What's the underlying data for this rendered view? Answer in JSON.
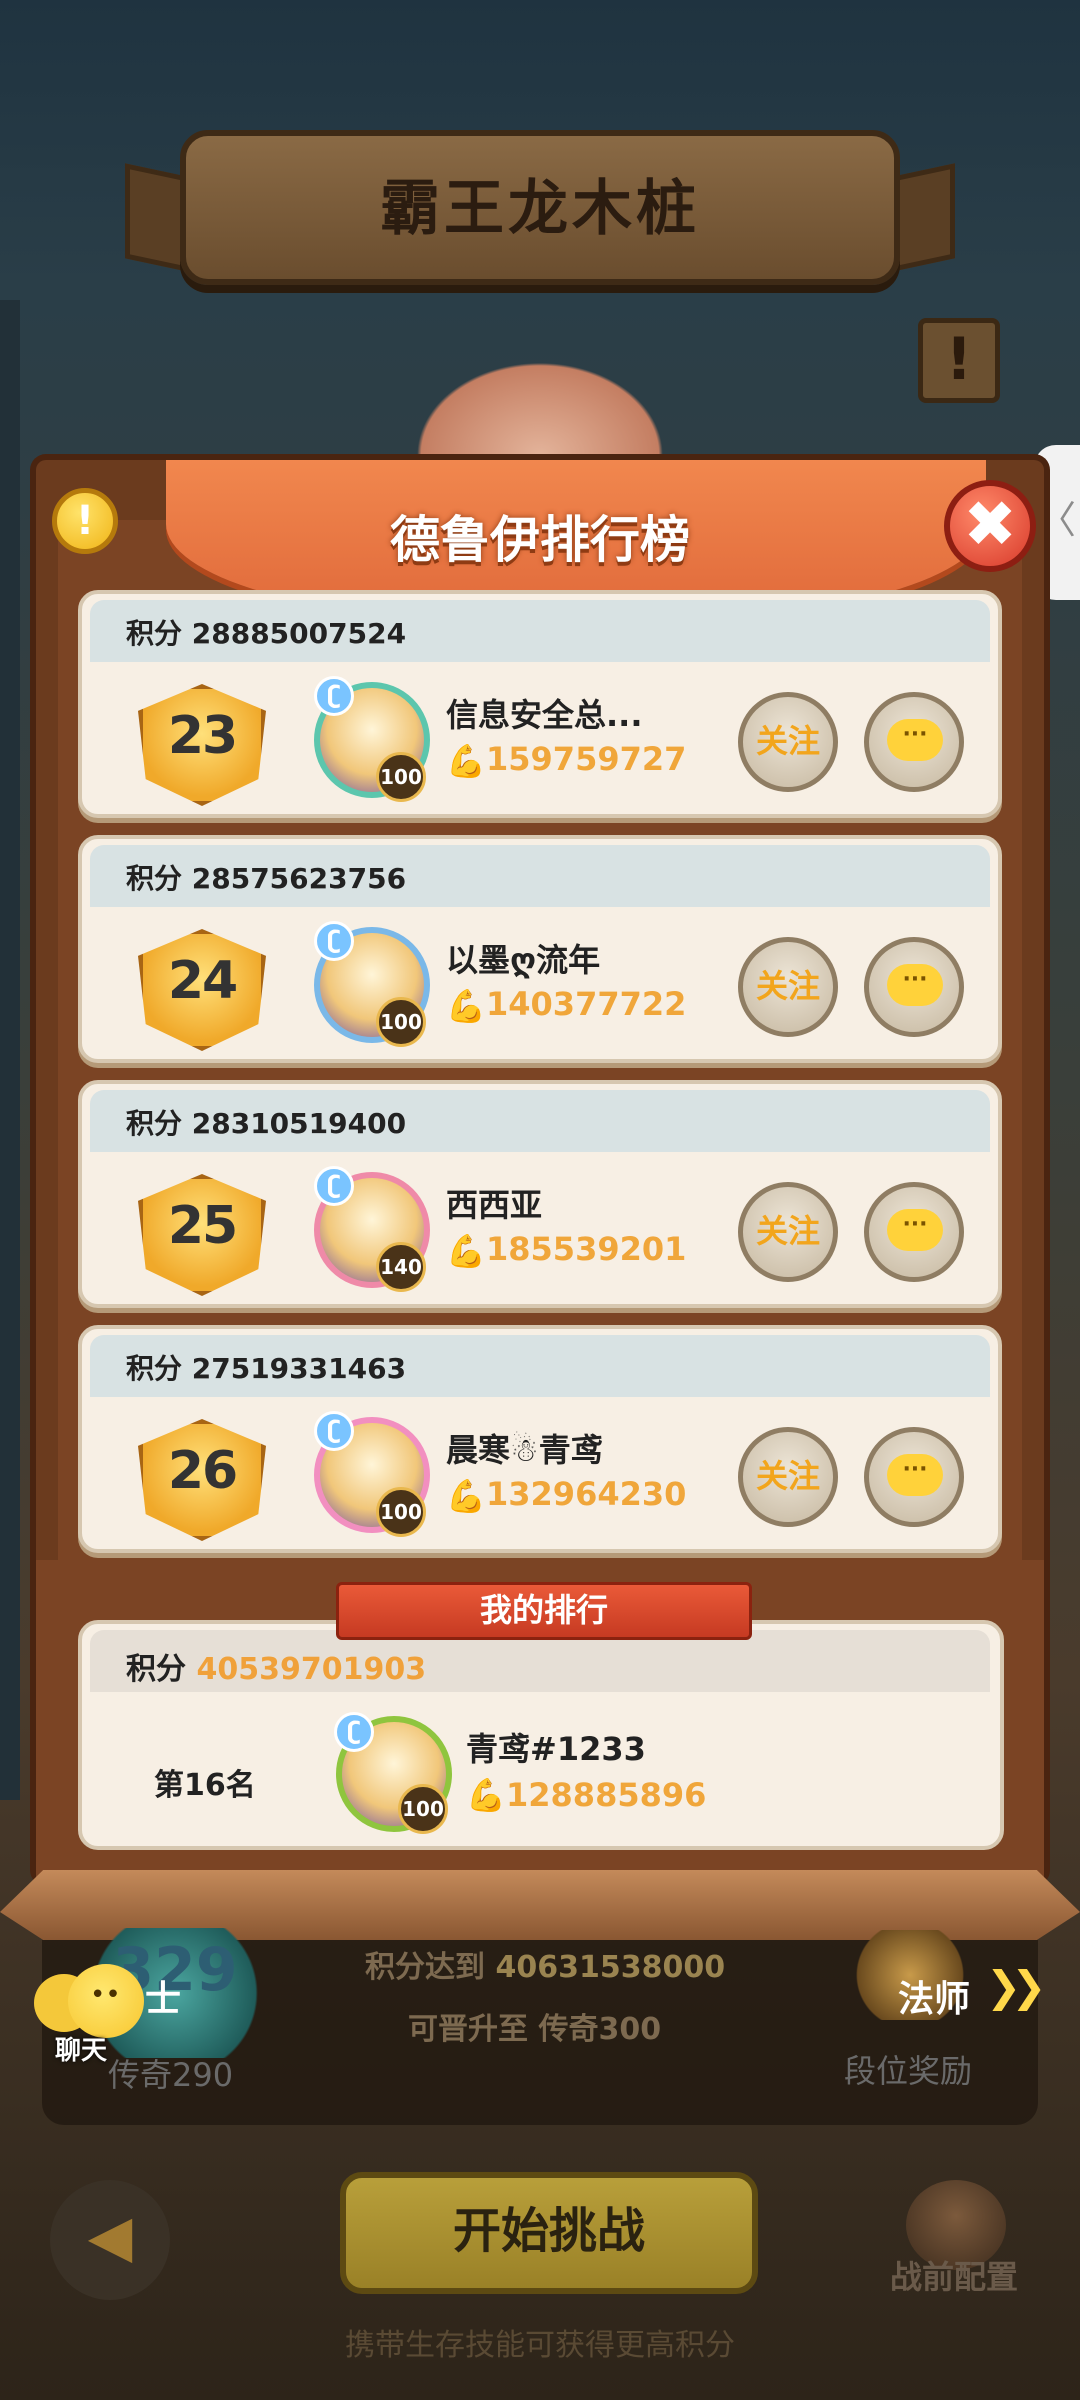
{
  "page": {
    "title": "霸王龙木桩",
    "side_handle_glyph": "〈",
    "sign_glyph": "!"
  },
  "panel": {
    "title": "德鲁伊排行榜",
    "info_glyph": "!",
    "close_glyph": "✖"
  },
  "rank_list": [
    {
      "score_label": "积分 28885007524",
      "rank": "23",
      "level": "100",
      "name": "信息安全总...",
      "power": "159759727",
      "follow": "关注",
      "chat": "···"
    },
    {
      "score_label": "积分 28575623756",
      "rank": "24",
      "level": "100",
      "name": "以墨ღ流年",
      "power": "140377722",
      "follow": "关注",
      "chat": "···"
    },
    {
      "score_label": "积分 28310519400",
      "rank": "25",
      "level": "140",
      "name": "西西亚",
      "power": "185539201",
      "follow": "关注",
      "chat": "···"
    },
    {
      "score_label": "积分 27519331463",
      "rank": "26",
      "level": "100",
      "name": "晨寒☃青鸢",
      "power": "132964230",
      "follow": "关注",
      "chat": "···"
    }
  ],
  "my_rank": {
    "ribbon": "我的排行",
    "score_prefix": "积分 ",
    "score": "40539701903",
    "rank_text": "第16名",
    "level": "100",
    "name": "青鸢#1233",
    "power": "128885896"
  },
  "bottom": {
    "tier_left_number": "329",
    "tier_left_name": "士",
    "tier_left_label": "传奇290",
    "promo_prefix": "积分达到 ",
    "promo_score": "40631538000",
    "promo_line2": "可晋升至 传奇300",
    "tier_right_name": "法师",
    "chevrons": "❯❯",
    "reward_label": "段位奖励",
    "chat_label": "聊天",
    "back_glyph": "◀",
    "start_label": "开始挑战",
    "prebattle_label": "战前配置",
    "hint": "携带生存技能可获得更高积分"
  },
  "colors": {
    "accent_gold": "#f0a63a",
    "panel_brown": "#7b4424",
    "ribbon_orange": "#e0693a",
    "card_bg": "#f7efe4"
  },
  "icons": [
    "info-icon",
    "close-icon",
    "arm-icon",
    "chat-icon",
    "back-arrow-icon",
    "chevron-right-icon"
  ]
}
